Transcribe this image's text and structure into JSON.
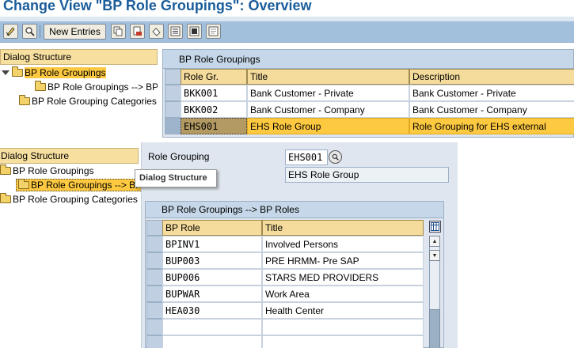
{
  "window": {
    "title": "Change View \"BP Role Groupings\": Overview"
  },
  "toolbar": {
    "new_entries_label": "New Entries",
    "icons": [
      "display-change-icon",
      "details-icon",
      "copy-icon",
      "delete-icon",
      "undo-icon",
      "select-all-icon",
      "select-block-icon",
      "deselect-all-icon"
    ]
  },
  "dialog_structure": {
    "header": "Dialog Structure",
    "items": [
      {
        "label": "BP Role Groupings"
      },
      {
        "label": "BP Role Groupings --> BP Roles"
      },
      {
        "label": "BP Role Grouping Categories"
      }
    ]
  },
  "groupings_table": {
    "title": "BP Role Groupings",
    "columns": [
      "Role Gr.",
      "Title",
      "Description"
    ],
    "rows": [
      {
        "role": "BKK001",
        "title": "Bank Customer - Private",
        "description": "Bank Customer - Private"
      },
      {
        "role": "BKK002",
        "title": "Bank Customer - Company",
        "description": "Bank Customer - Company"
      },
      {
        "role": "EHS001",
        "title": "EHS Role Group",
        "description": "Role Grouping for EHS external"
      }
    ]
  },
  "lower_tree": {
    "header": "Dialog Structure",
    "items": [
      {
        "label": "BP Role Groupings"
      },
      {
        "label": "BP Role Groupings --> BP Roles"
      },
      {
        "label": "BP Role Grouping Categories"
      }
    ]
  },
  "detail": {
    "role_grouping_label": "Role Grouping",
    "role_grouping_value": "EHS001",
    "title_value": "EHS Role Group"
  },
  "tooltip": {
    "text": "Dialog Structure"
  },
  "roles_table": {
    "title": "BP Role Groupings --> BP Roles",
    "columns": [
      "BP Role",
      "Title"
    ],
    "rows": [
      {
        "role": "BPINV1",
        "title": "Involved Persons"
      },
      {
        "role": "BUP003",
        "title": "PRE HRMM- Pre SAP"
      },
      {
        "role": "BUP006",
        "title": "STARS MED PROVIDERS"
      },
      {
        "role": "BUPWAR",
        "title": "Work Area"
      },
      {
        "role": "HEA030",
        "title": "Health Center"
      },
      {
        "role": "",
        "title": ""
      },
      {
        "role": "",
        "title": ""
      }
    ]
  },
  "colors": {
    "title": "#1a5c9a",
    "toolbar": "#a2c0dc",
    "header_gold": "#f6dc9c",
    "selection": "#fdc940",
    "grid_bg": "#dfe6ef"
  }
}
